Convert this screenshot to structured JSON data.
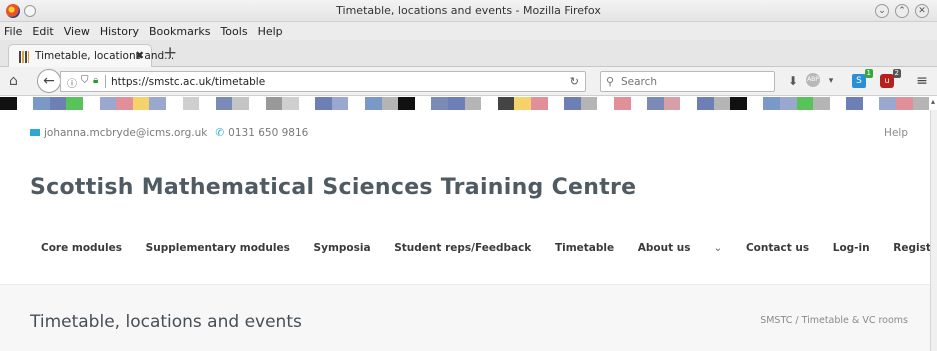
{
  "window": {
    "title": "Timetable, locations and events - Mozilla Firefox",
    "controls": [
      "minimize",
      "maximize",
      "close"
    ]
  },
  "menubar": {
    "items": [
      "File",
      "Edit",
      "View",
      "History",
      "Bookmarks",
      "Tools",
      "Help"
    ]
  },
  "tabs": [
    {
      "label": "Timetable, locations and...",
      "close": "✖"
    }
  ],
  "newtab": {
    "label": "+"
  },
  "navbar": {
    "url": "https://smstc.ac.uk/timetable",
    "search_placeholder": "Search",
    "ext1_badge": "1",
    "ext2_badge": "2",
    "abp_label": "ABP"
  },
  "colorstrip": [
    "#111111",
    "#ffffff",
    "#7b99c6",
    "#6d7fb5",
    "#58c35a",
    "#ffffff",
    "#9aa8d0",
    "#e1909a",
    "#f5d36a",
    "#9aa8d0",
    "#ffffff",
    "#cfcfcf",
    "#ffffff",
    "#7b8bb8",
    "#c4c4c4",
    "#ffffff",
    "#999999",
    "#cfcfcf",
    "#ffffff",
    "#6d7fb5",
    "#9aa8d0",
    "#ffffff",
    "#7b99c6",
    "#b5b5b5",
    "#111111",
    "#ffffff",
    "#7b8bb8",
    "#6d7fb5",
    "#b5b5b5",
    "#ffffff",
    "#444444",
    "#f5d36a",
    "#e1909a",
    "#ffffff",
    "#6d7fb5",
    "#b5b5b5",
    "#ffffff",
    "#e1909a",
    "#ffffff",
    "#7b8bb8",
    "#d7a0a8",
    "#ffffff",
    "#6d7fb5",
    "#b5b5b5",
    "#111111",
    "#ffffff",
    "#7b99c6",
    "#9aa8d0",
    "#58c35a",
    "#b5b5b5",
    "#ffffff",
    "#6d7fb5",
    "#ffffff",
    "#9aa8d0",
    "#e1909a",
    "#b5b5b5"
  ],
  "contact": {
    "email": "johanna.mcbryde@icms.org.uk",
    "phone": "0131 650 9816"
  },
  "help": "Help",
  "site_title": "Scottish Mathematical Sciences Training Centre",
  "mainnav": [
    "Core modules",
    "Supplementary modules",
    "Symposia",
    "Student reps/Feedback",
    "Timetable",
    "About us",
    "Contact us",
    "Log-in",
    "Register"
  ],
  "page_title": "Timetable, locations and events",
  "breadcrumb": "SMSTC / Timetable & VC rooms"
}
